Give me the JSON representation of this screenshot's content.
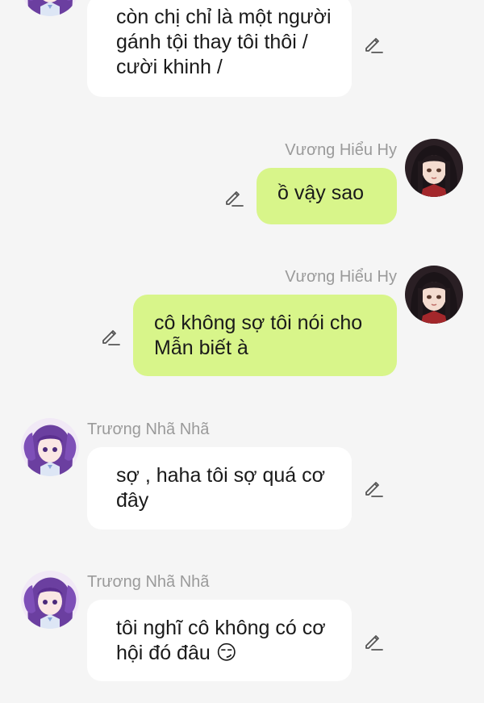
{
  "messages": [
    {
      "side": "left",
      "sender": "",
      "text": "còn chị chỉ là một người gánh tội thay tôi thôi / cười khinh /"
    },
    {
      "side": "right",
      "sender": "Vương Hiểu Hy",
      "text": "ồ vậy sao"
    },
    {
      "side": "right",
      "sender": "Vương Hiểu Hy",
      "text": "cô không sợ tôi nói cho Mẫn biết à"
    },
    {
      "side": "left",
      "sender": "Trương Nhã Nhã",
      "text": "sợ , haha tôi sợ quá cơ đây"
    },
    {
      "side": "left",
      "sender": "Trương Nhã Nhã",
      "text": "tôi nghĩ cô không có cơ hội đó đâu 😏"
    }
  ],
  "colors": {
    "background": "#f5f5f5",
    "left_bubble": "#ffffff",
    "right_bubble": "#d8f58a",
    "name_text": "#9a9a9a",
    "icon": "#555555"
  },
  "icons": {
    "edit": "pencil-icon",
    "avatar_left": "purple-haired-girl-avatar",
    "avatar_right": "dark-haired-girl-avatar"
  }
}
